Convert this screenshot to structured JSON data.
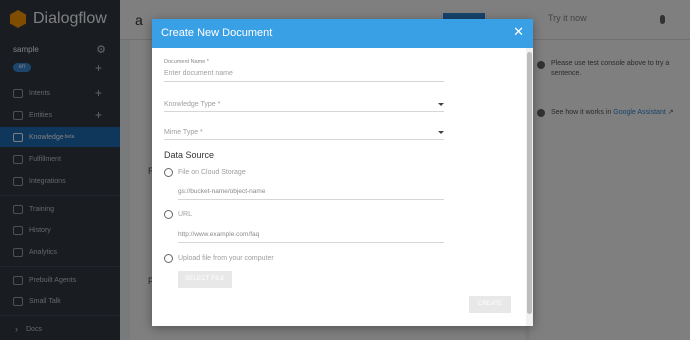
{
  "brand": {
    "name": "Dialogflow"
  },
  "agent": {
    "name": "sample",
    "language": "en"
  },
  "sidebar": {
    "items": [
      {
        "label": "Intents"
      },
      {
        "label": "Entities"
      },
      {
        "label": "Knowledge",
        "badge": "beta"
      },
      {
        "label": "Fulfillment"
      },
      {
        "label": "Integrations"
      },
      {
        "label": "Training"
      },
      {
        "label": "History"
      },
      {
        "label": "Analytics"
      },
      {
        "label": "Prebuilt Agents"
      },
      {
        "label": "Small Talk"
      },
      {
        "label": "Docs"
      }
    ]
  },
  "topbar": {
    "letter": "a",
    "test_label": "Try it now"
  },
  "main": {
    "letter_r": "R",
    "letter_f": "F"
  },
  "right_panel": {
    "help_text": "Please use test console above to try a sentence.",
    "ga_prefix": "See how it works in ",
    "ga_link": "Google Assistant"
  },
  "modal": {
    "title": "Create New Document",
    "close": "✕",
    "document_name_label": "Document Name *",
    "document_name_placeholder": "Enter document name",
    "knowledge_type_placeholder": "Knowledge Type *",
    "mime_type_placeholder": "Mime Type *",
    "data_source_title": "Data Source",
    "options": [
      {
        "label": "File on Cloud Storage",
        "placeholder": "gs://bucket-name/object-name"
      },
      {
        "label": "URL",
        "placeholder": "http://www.example.com/faq"
      },
      {
        "label": "Upload file from your computer"
      }
    ],
    "select_file_label": "SELECT FILE",
    "create_label": "CREATE"
  }
}
